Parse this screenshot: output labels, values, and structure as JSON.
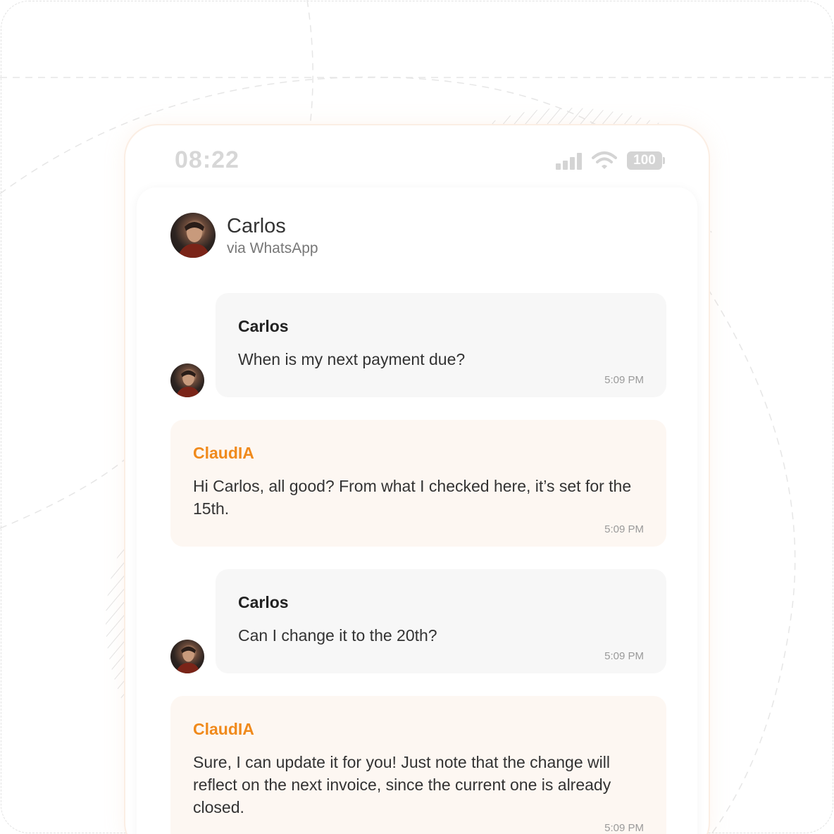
{
  "status_bar": {
    "time": "08:22",
    "battery": "100",
    "icons": [
      "signal-icon",
      "wifi-icon",
      "battery-icon"
    ]
  },
  "contact": {
    "name": "Carlos",
    "channel": "via WhatsApp"
  },
  "messages": [
    {
      "sender": "Carlos",
      "role": "user",
      "text": "When is my next payment due?",
      "time": "5:09 PM"
    },
    {
      "sender": "ClaudIA",
      "role": "assistant",
      "text": "Hi Carlos, all good? From what I checked here, it’s set for the 15th.",
      "time": "5:09 PM"
    },
    {
      "sender": "Carlos",
      "role": "user",
      "text": "Can I change it to the 20th?",
      "time": "5:09 PM"
    },
    {
      "sender": "ClaudIA",
      "role": "assistant",
      "text": "Sure, I can update it for you! Just note that the change will reflect on the next invoice, since the current one is already closed.",
      "time": "5:09 PM"
    }
  ],
  "colors": {
    "assistant_name": "#f08a1c",
    "assistant_bubble": "#fdf7f2",
    "user_bubble": "#f7f7f7",
    "phone_border": "#fbeee4"
  }
}
